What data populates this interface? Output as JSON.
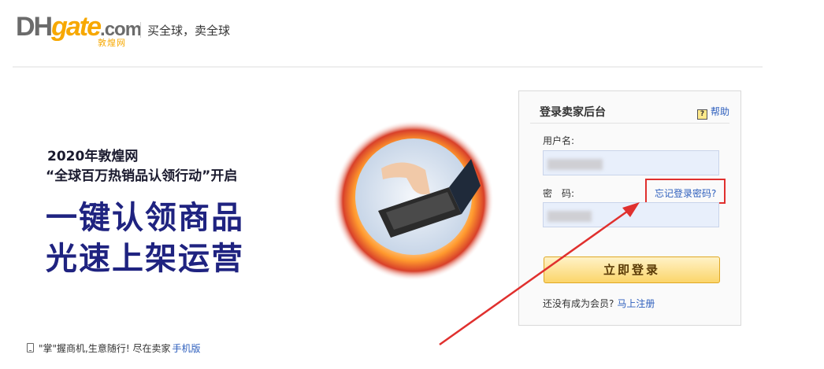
{
  "header": {
    "logo_dh": "DH",
    "logo_gate": "gate",
    "logo_com": ".com",
    "logo_cn": "敦煌网",
    "slogan": "买全球，卖全球"
  },
  "banner": {
    "line1": "2020年敦煌网",
    "line2": "“全球百万热销品认领行动”开启",
    "big1": "一键认领商品",
    "big2": "光速上架运营"
  },
  "mobile_tip": {
    "text": "\"掌\"握商机,生意随行! 尽在卖家",
    "link": "手机版"
  },
  "login": {
    "title": "登录卖家后台",
    "help_label": "帮助",
    "username_label": "用户名:",
    "password_label": "密　码:",
    "forgot_link": "忘记登录密码?",
    "submit_label": "立即登录",
    "register_prompt": "还没有成为会员?",
    "register_link": "马上注册"
  },
  "colors": {
    "accent_blue": "#2e5fbd",
    "annotation_red": "#e0302e",
    "button_gold": "#fbd56a",
    "banner_navy": "#1f2380"
  },
  "icons": {
    "help": "question-mark-icon",
    "mobile": "phone-icon",
    "annotation": "red-arrow"
  }
}
